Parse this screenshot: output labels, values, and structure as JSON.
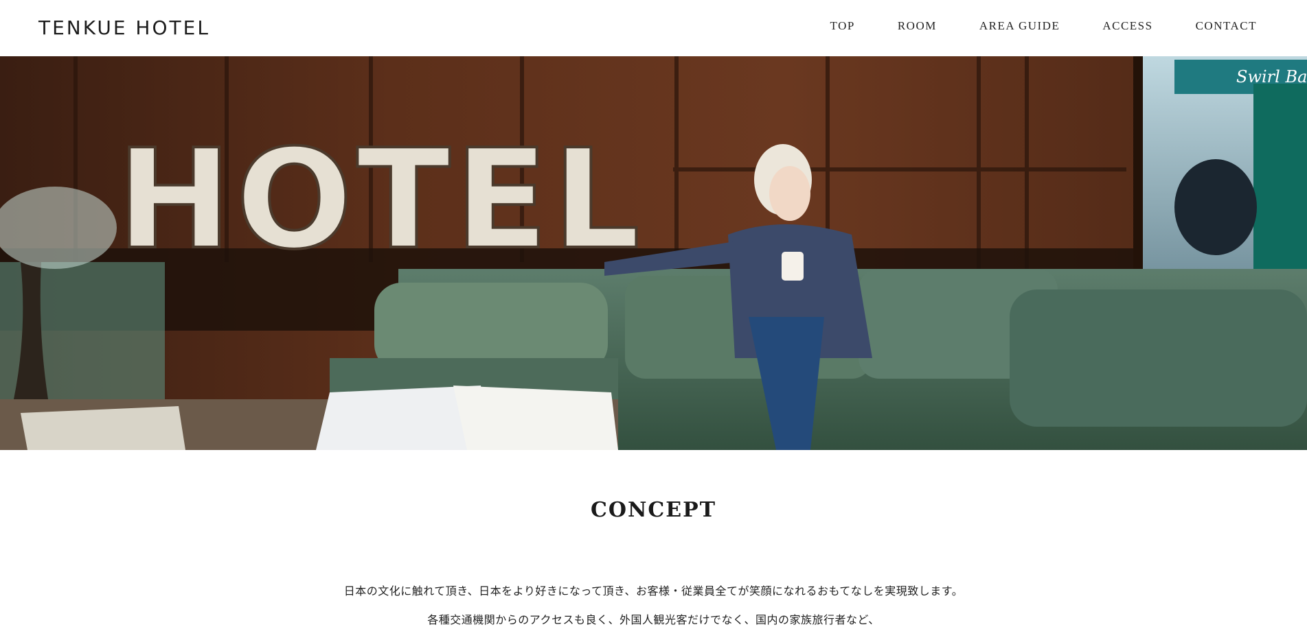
{
  "header": {
    "logo": "TENKUE HOTEL",
    "nav": [
      "TOP",
      "ROOM",
      "AREA GUIDE",
      "ACCESS",
      "CONTACT"
    ]
  },
  "hero": {
    "sign_text": "HOTEL",
    "street_sign": "Swirl Bar"
  },
  "concept": {
    "title": "CONCEPT",
    "lines": [
      "日本の文化に触れて頂き、日本をより好きになって頂き、お客様・従業員全てが笑顔になれるおもてなしを実現致します。",
      "各種交通機関からのアクセスも良く、外国人観光客だけでなく、国内の家族旅行者など、"
    ]
  },
  "colors": {
    "wood": "#5a2e1a",
    "sofa": "#4a6b5c",
    "sign": "#e8e2d6",
    "text": "#222222"
  }
}
